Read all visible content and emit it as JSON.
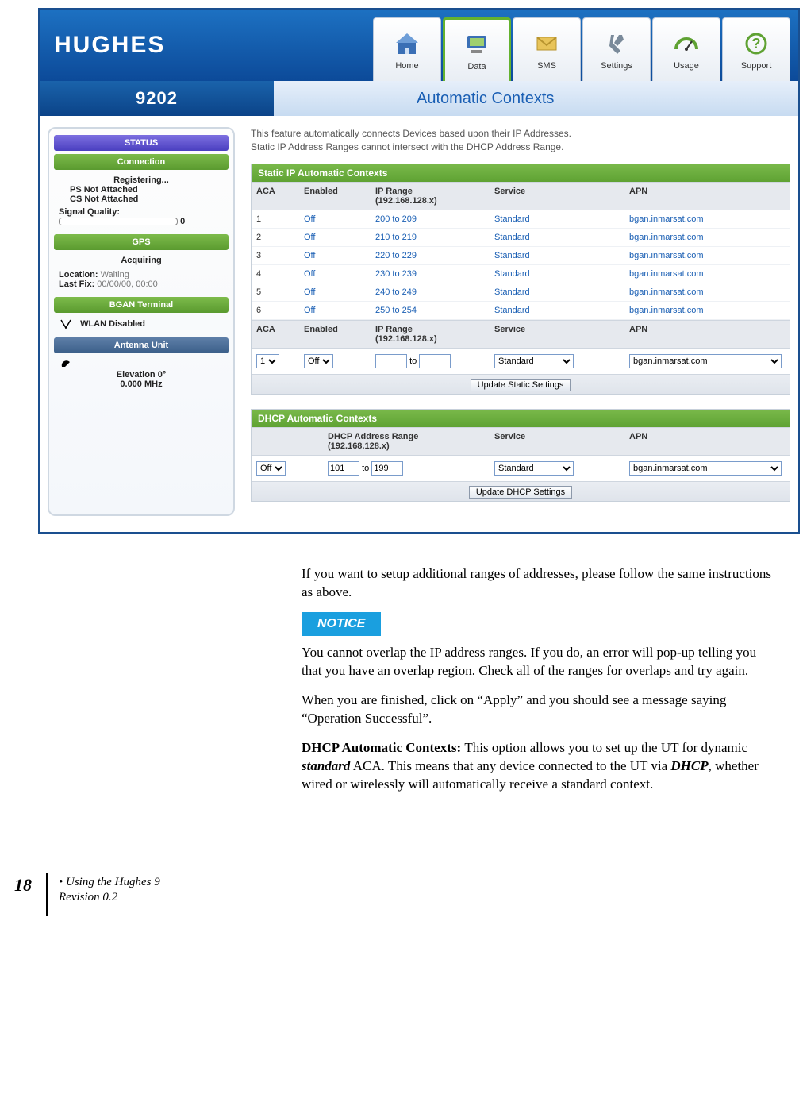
{
  "header": {
    "logo": "HUGHES",
    "model": "9202",
    "nav": [
      {
        "label": "Home",
        "icon": "home"
      },
      {
        "label": "Data",
        "icon": "data",
        "active": true
      },
      {
        "label": "SMS",
        "icon": "sms"
      },
      {
        "label": "Settings",
        "icon": "settings"
      },
      {
        "label": "Usage",
        "icon": "usage"
      },
      {
        "label": "Support",
        "icon": "support"
      }
    ],
    "page_title": "Automatic Contexts"
  },
  "sidebar": {
    "status_hdr": "STATUS",
    "connection_hdr": "Connection",
    "conn_lines": [
      "Registering...",
      "PS Not Attached",
      "CS Not Attached"
    ],
    "signal_label": "Signal Quality:",
    "signal_value": "0",
    "gps_hdr": "GPS",
    "gps_status": "Acquiring",
    "gps_loc_label": "Location:",
    "gps_loc_value": "Waiting",
    "gps_fix_label": "Last Fix:",
    "gps_fix_value": "00/00/00, 00:00",
    "bgan_hdr": "BGAN Terminal",
    "wlan": "WLAN Disabled",
    "ant_hdr": "Antenna Unit",
    "elev": "Elevation 0°",
    "freq": "0.000 MHz"
  },
  "main": {
    "intro_l1": "This feature automatically connects Devices based upon their IP Addresses.",
    "intro_l2": "Static IP Address Ranges cannot intersect with the DHCP Address Range.",
    "static": {
      "title": "Static IP Automatic Contexts",
      "cols": {
        "aca": "ACA",
        "enabled": "Enabled",
        "range": "IP Range\n(192.168.128.x)",
        "service": "Service",
        "apn": "APN"
      },
      "rows": [
        {
          "aca": "1",
          "enabled": "Off",
          "range": "200 to 209",
          "service": "Standard",
          "apn": "bgan.inmarsat.com"
        },
        {
          "aca": "2",
          "enabled": "Off",
          "range": "210 to 219",
          "service": "Standard",
          "apn": "bgan.inmarsat.com"
        },
        {
          "aca": "3",
          "enabled": "Off",
          "range": "220 to 229",
          "service": "Standard",
          "apn": "bgan.inmarsat.com"
        },
        {
          "aca": "4",
          "enabled": "Off",
          "range": "230 to 239",
          "service": "Standard",
          "apn": "bgan.inmarsat.com"
        },
        {
          "aca": "5",
          "enabled": "Off",
          "range": "240 to 249",
          "service": "Standard",
          "apn": "bgan.inmarsat.com"
        },
        {
          "aca": "6",
          "enabled": "Off",
          "range": "250 to 254",
          "service": "Standard",
          "apn": "bgan.inmarsat.com"
        }
      ],
      "form": {
        "aca_opt": "1",
        "enabled_opt": "Off",
        "low": "",
        "to": "to",
        "high": "",
        "service_opt": "Standard",
        "apn_val": "bgan.inmarsat.com"
      },
      "update_btn": "Update Static Settings"
    },
    "dhcp": {
      "title": "DHCP Automatic Contexts",
      "cols": {
        "enabled": "",
        "range": "DHCP Address Range\n(192.168.128.x)",
        "service": "Service",
        "apn": "APN"
      },
      "form": {
        "enabled_opt": "Off",
        "low": "101",
        "to": "to",
        "high": "199",
        "service_opt": "Standard",
        "apn_val": "bgan.inmarsat.com"
      },
      "update_btn": "Update DHCP Settings"
    }
  },
  "doc": {
    "p1": "If you want to setup additional ranges of addresses, please follow the same instructions as above.",
    "notice": "NOTICE",
    "p2": "You cannot overlap the IP address ranges.  If you do, an error will pop-up telling you that you have an overlap region.  Check all of the ranges for overlaps and try again.",
    "p3": "When you are finished, click on “Apply” and you should see a message saying “Operation Successful”.",
    "p4_lead": "DHCP Automatic Contexts:  ",
    "p4_a": "This option allows you to set up the UT for dynamic ",
    "p4_b": "standard",
    "p4_c": " ACA.  This means that any device connected to the UT via ",
    "p4_d": "DHCP",
    "p4_e": ", whether wired or wirelessly will automatically receive a standard context."
  },
  "footer": {
    "page": "18",
    "bullet": "•",
    "line1": " Using the Hughes 9",
    "line2": "Revision 0.2"
  }
}
